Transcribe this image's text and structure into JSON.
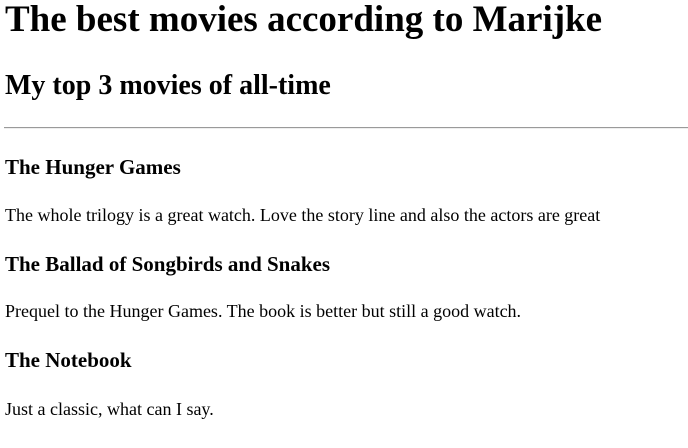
{
  "header": {
    "title": "The best movies according to Marijke",
    "subtitle": "My top 3 movies of all-time"
  },
  "movies": [
    {
      "title": "The Hunger Games",
      "description": "The whole trilogy is a great watch. Love the story line and also the actors are great"
    },
    {
      "title": "The Ballad of Songbirds and Snakes",
      "description": "Prequel to the Hunger Games. The book is better but still a good watch."
    },
    {
      "title": "The Notebook",
      "description": "Just a classic, what can I say."
    }
  ]
}
